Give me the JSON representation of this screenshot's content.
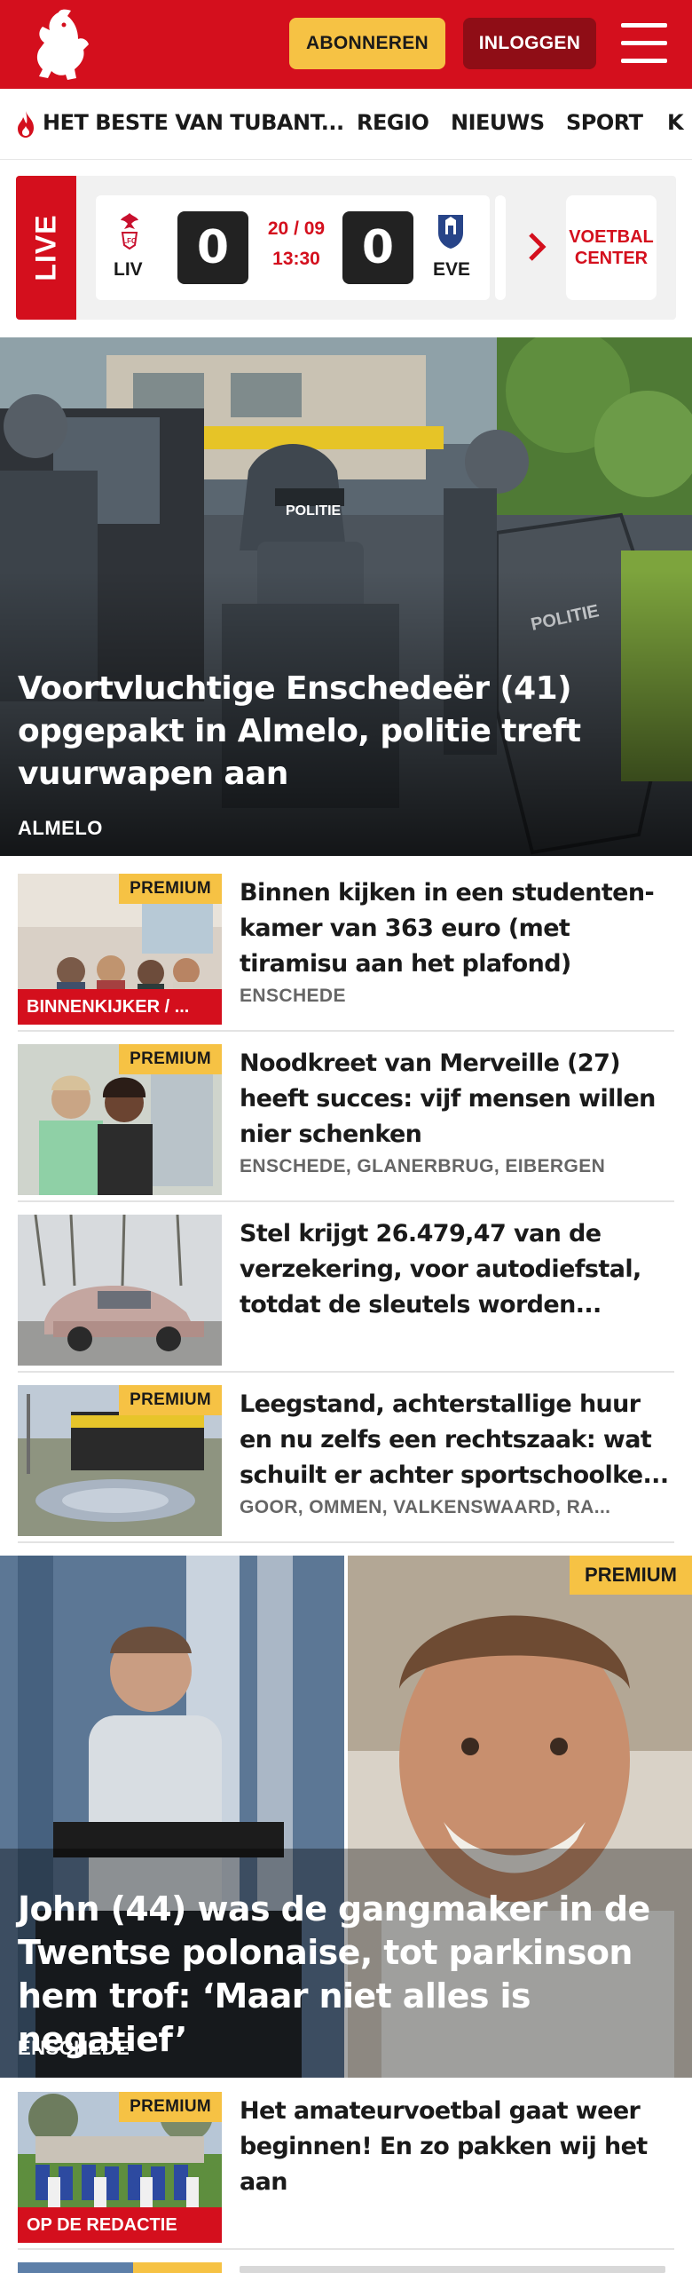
{
  "header": {
    "subscribe_label": "ABONNEREN",
    "login_label": "INLOGGEN",
    "brand_color": "#d40f1d"
  },
  "nav": {
    "items": [
      {
        "label": "HET BESTE VAN TUBANT..."
      },
      {
        "label": "REGIO"
      },
      {
        "label": "NIEUWS"
      },
      {
        "label": "SPORT"
      },
      {
        "label": "K"
      }
    ]
  },
  "live": {
    "label": "LIVE",
    "home_team": "LIV",
    "away_team": "EVE",
    "home_score": "0",
    "away_score": "0",
    "date": "20 / 09",
    "time": "13:30",
    "voetbal_center_line1": "VOETBAL",
    "voetbal_center_line2": "CENTER"
  },
  "hero": {
    "title": "Voortvluchtige Enschedeër (41) opgepakt in Almelo, politie treft vuurwapen aan",
    "location": "ALMELO"
  },
  "articles": [
    {
      "premium": "PREMIUM",
      "tag": "BINNENKIJKER / ...",
      "title": "Binnen kijken in een studenten­kamer van 363 euro (met tiramisu aan het plafond)",
      "place": "ENSCHEDE"
    },
    {
      "premium": "PREMIUM",
      "title": "Noodkreet van Merveille (27) heeft succes: vijf mensen willen nier schenken",
      "place": "ENSCHEDE, GLANERBRUG, EIBERGEN"
    },
    {
      "title": "Stel krijgt 26.479,47 van de verzekering, voor autodiefstal, totdat de sleutels worden..."
    },
    {
      "premium": "PREMIUM",
      "title": "Leegstand, achterstallige huur en nu zelfs een rechtszaak: wat schuilt er achter sportschoolke...",
      "place": "GOOR, OMMEN, VALKENSWAARD, RA..."
    }
  ],
  "feature": {
    "premium": "PREMIUM",
    "title": "John (44) was de gangmaker in de Twentse polonaise, tot parkinson hem trof: ‘Maar niet alles is negatief’",
    "location": "ENSCHEDE"
  },
  "bottom_article": {
    "premium": "PREMIUM",
    "tag": "OP DE REDACTIE",
    "title": "Het amateurvoetbal gaat weer beginnen! En zo pakken wij het aan"
  },
  "partial_article": {
    "premium": "PREMIUM"
  }
}
